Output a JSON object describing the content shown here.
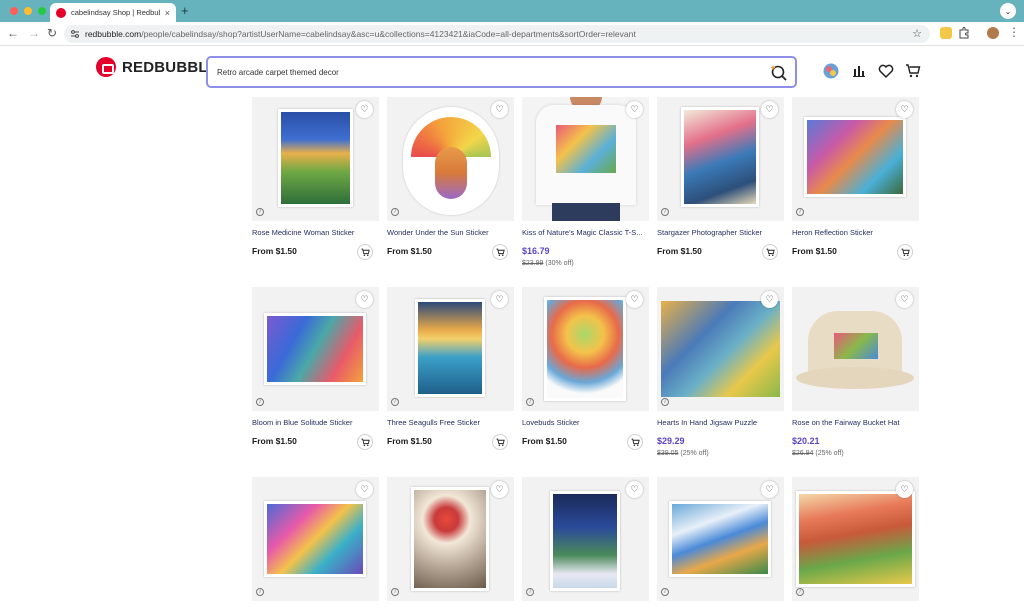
{
  "browser": {
    "tab_title": "cabelindsay Shop | Redbubble",
    "url_host": "redbubble.com",
    "url_path": "/people/cabelindsay/shop?artistUserName=cabelindsay&asc=u&collections=4123421&iaCode=all-departments&sortOrder=relevant",
    "new_tab": "+",
    "tab_close": "×",
    "menu_chevron": "⌄"
  },
  "header": {
    "logo": "REDBUBBLE",
    "search_value": "Retro arcade carpet themed decor"
  },
  "products": [
    {
      "title": "Rose Medicine Woman Sticker",
      "price": "From $1.50",
      "sale": false
    },
    {
      "title": "Wonder Under the Sun Sticker",
      "price": "From $1.50",
      "sale": false
    },
    {
      "title": "Kiss of Nature's Magic Classic T-S...",
      "price": "$16.79",
      "original": "$23.99",
      "discount": "(30% off)",
      "sale": true
    },
    {
      "title": "Stargazer Photographer Sticker",
      "price": "From $1.50",
      "sale": false
    },
    {
      "title": "Heron Reflection Sticker",
      "price": "From $1.50",
      "sale": false
    },
    {
      "title": "Bloom in Blue Solitude Sticker",
      "price": "From $1.50",
      "sale": false
    },
    {
      "title": "Three Seagulls Free Sticker",
      "price": "From $1.50",
      "sale": false
    },
    {
      "title": "Lovebuds Sticker",
      "price": "From $1.50",
      "sale": false
    },
    {
      "title": "Hearts In Hand Jigsaw Puzzle",
      "price": "$29.29",
      "original": "$39.05",
      "discount": "(25% off)",
      "sale": true
    },
    {
      "title": "Rose on the Fairway Bucket Hat",
      "price": "$20.21",
      "original": "$26.94",
      "discount": "(25% off)",
      "sale": true
    },
    {
      "title": "",
      "price": "",
      "sale": false
    },
    {
      "title": "",
      "price": "",
      "sale": false
    },
    {
      "title": "",
      "price": "",
      "sale": false
    },
    {
      "title": "",
      "price": "",
      "sale": false
    },
    {
      "title": "",
      "price": "",
      "sale": false
    }
  ],
  "colors": {
    "tabbar": "#66b3bd",
    "brand_red": "#e4002b",
    "sale_price": "#5d43c6",
    "title_text": "#1f2a5c"
  },
  "icons": {
    "favorite": "heart-icon",
    "cart": "add-to-cart-icon",
    "info": "info-icon"
  }
}
